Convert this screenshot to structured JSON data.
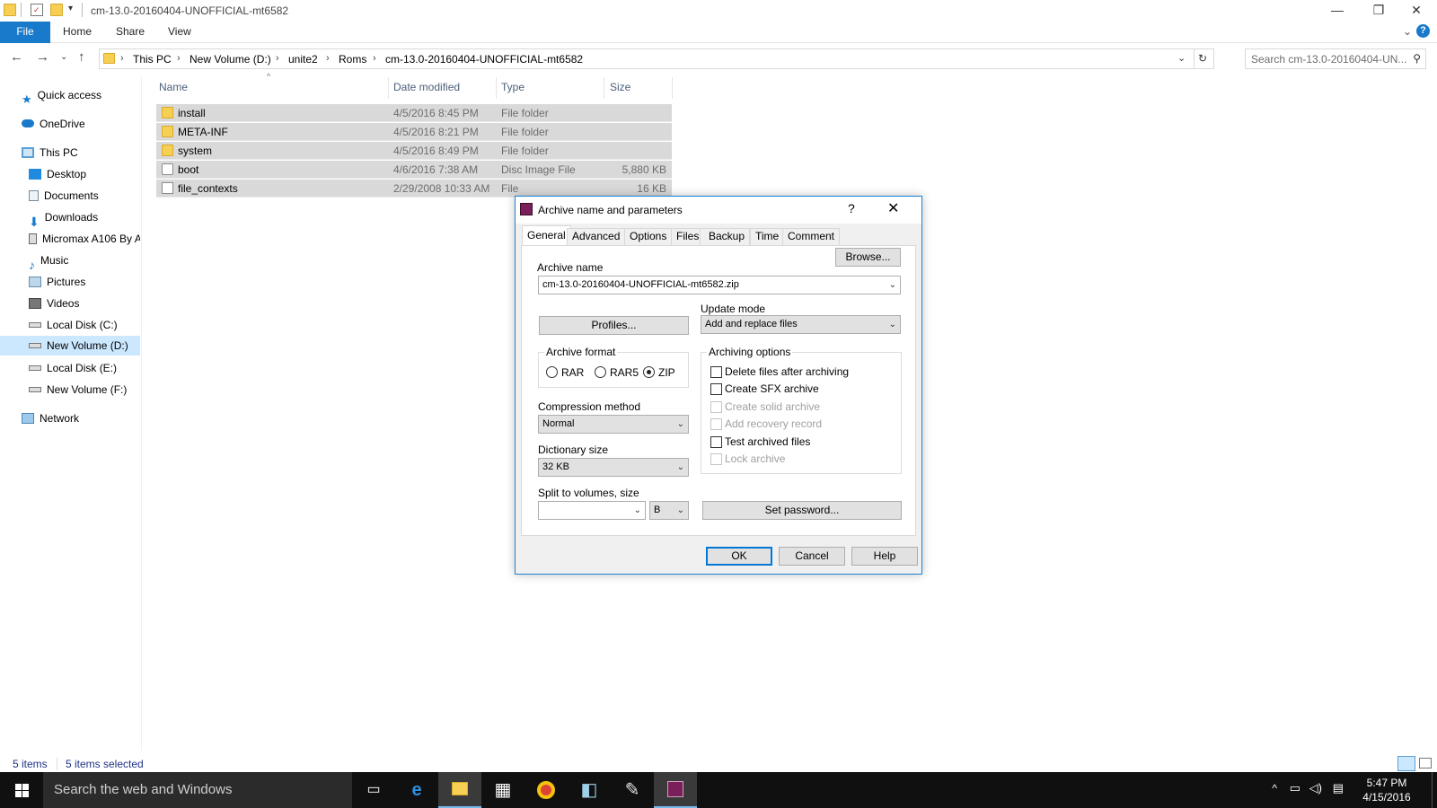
{
  "window": {
    "title": "cm-13.0-20160404-UNOFFICIAL-mt6582",
    "controls": {
      "minimize": "—",
      "restore": "❐",
      "close": "✕"
    }
  },
  "ribbon": {
    "tabs": [
      "File",
      "Home",
      "Share",
      "View"
    ],
    "help": "?",
    "expand": "⌄"
  },
  "address": {
    "breadcrumbs": [
      "This PC",
      "New Volume (D:)",
      "unite2",
      "Roms",
      "cm-13.0-20160404-UNOFFICIAL-mt6582"
    ],
    "search_placeholder": "Search cm-13.0-20160404-UN..."
  },
  "nav": {
    "items": [
      {
        "label": "Quick access",
        "icon": "star-icon"
      },
      {
        "label": "OneDrive",
        "icon": "cloud-icon"
      },
      {
        "label": "This PC",
        "icon": "computer-icon"
      },
      {
        "label": "Desktop",
        "icon": "desktop-icon"
      },
      {
        "label": "Documents",
        "icon": "documents-icon"
      },
      {
        "label": "Downloads",
        "icon": "downloads-icon"
      },
      {
        "label": "Micromax A106 By A",
        "icon": "phone-icon"
      },
      {
        "label": "Music",
        "icon": "music-icon"
      },
      {
        "label": "Pictures",
        "icon": "pictures-icon"
      },
      {
        "label": "Videos",
        "icon": "videos-icon"
      },
      {
        "label": "Local Disk (C:)",
        "icon": "drive-icon"
      },
      {
        "label": "New Volume (D:)",
        "icon": "drive-icon"
      },
      {
        "label": "Local Disk (E:)",
        "icon": "drive-icon"
      },
      {
        "label": "New Volume (F:)",
        "icon": "drive-icon"
      },
      {
        "label": "Network",
        "icon": "network-icon"
      }
    ]
  },
  "files": {
    "columns": [
      "Name",
      "Date modified",
      "Type",
      "Size"
    ],
    "rows": [
      {
        "name": "install",
        "date": "4/5/2016 8:45 PM",
        "type": "File folder",
        "size": "",
        "icon": "folder-icon"
      },
      {
        "name": "META-INF",
        "date": "4/5/2016 8:21 PM",
        "type": "File folder",
        "size": "",
        "icon": "folder-icon"
      },
      {
        "name": "system",
        "date": "4/5/2016 8:49 PM",
        "type": "File folder",
        "size": "",
        "icon": "folder-icon"
      },
      {
        "name": "boot",
        "date": "4/6/2016 7:38 AM",
        "type": "Disc Image File",
        "size": "5,880 KB",
        "icon": "disc-image-icon"
      },
      {
        "name": "file_contexts",
        "date": "2/29/2008 10:33 AM",
        "type": "File",
        "size": "16 KB",
        "icon": "file-icon"
      }
    ]
  },
  "status": {
    "count": "5 items",
    "selected": "5 items selected"
  },
  "dialog": {
    "title": "Archive name and parameters",
    "help": "?",
    "close": "✕",
    "tabs": [
      "General",
      "Advanced",
      "Options",
      "Files",
      "Backup",
      "Time",
      "Comment"
    ],
    "archive_name_label": "Archive name",
    "archive_name_value": "cm-13.0-20160404-UNOFFICIAL-mt6582.zip",
    "browse": "Browse...",
    "update_mode_label": "Update mode",
    "update_mode_value": "Add and replace files",
    "profiles": "Profiles...",
    "archive_format_label": "Archive format",
    "formats": [
      "RAR",
      "RAR5",
      "ZIP"
    ],
    "selected_format": "ZIP",
    "compression_label": "Compression method",
    "compression_value": "Normal",
    "dictionary_label": "Dictionary size",
    "dictionary_value": "32 KB",
    "split_label": "Split to volumes, size",
    "split_value": "",
    "split_unit": "B",
    "archiving_options_label": "Archiving options",
    "options": [
      {
        "label": "Delete files after archiving",
        "checked": false,
        "enabled": true
      },
      {
        "label": "Create SFX archive",
        "checked": false,
        "enabled": true
      },
      {
        "label": "Create solid archive",
        "checked": false,
        "enabled": false
      },
      {
        "label": "Add recovery record",
        "checked": false,
        "enabled": false
      },
      {
        "label": "Test archived files",
        "checked": false,
        "enabled": true
      },
      {
        "label": "Lock archive",
        "checked": false,
        "enabled": false
      }
    ],
    "set_password": "Set password...",
    "ok": "OK",
    "cancel": "Cancel",
    "help_button": "Help"
  },
  "taskbar": {
    "search_placeholder": "Search the web and Windows",
    "time": "5:47 PM",
    "date": "4/15/2016"
  },
  "colors": {
    "accent": "#1979ca",
    "selection": "#d9d9d9",
    "nav_selected": "#cce8ff",
    "taskbar": "#101010"
  }
}
